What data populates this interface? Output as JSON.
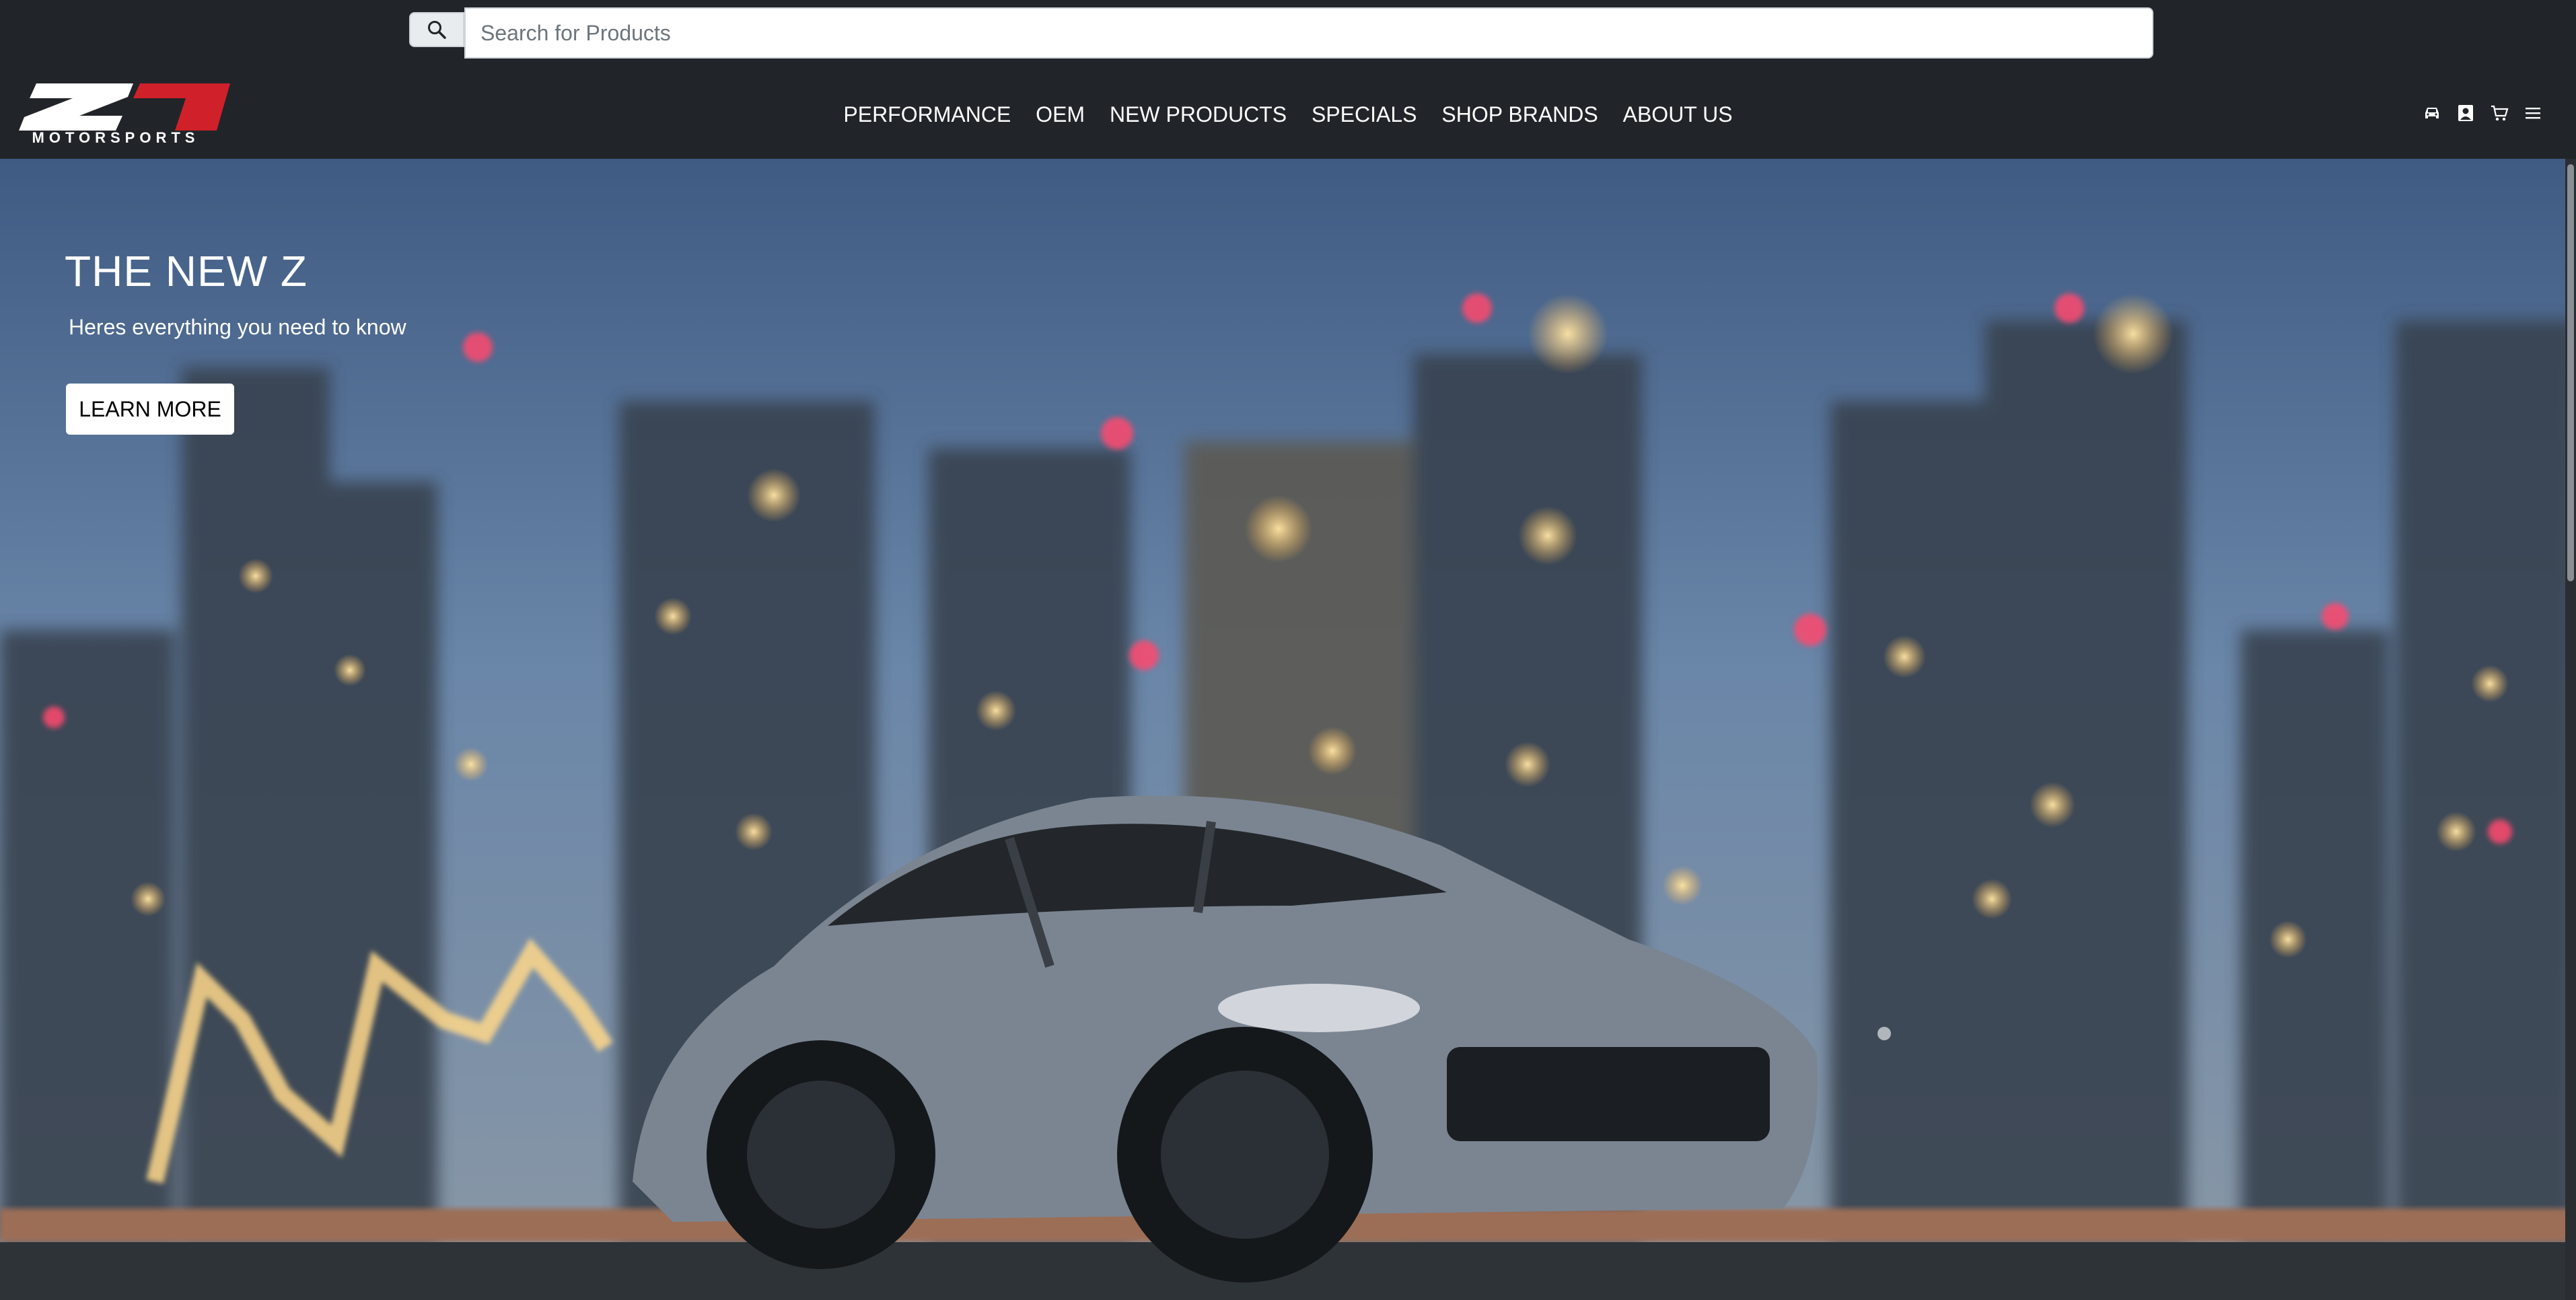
{
  "header": {
    "search": {
      "placeholder": "Search for Products",
      "value": ""
    },
    "logo": {
      "text": "MOTORSPORTS",
      "mark": "Z1"
    },
    "nav": [
      {
        "label": "PERFORMANCE"
      },
      {
        "label": "OEM"
      },
      {
        "label": "NEW PRODUCTS"
      },
      {
        "label": "SPECIALS"
      },
      {
        "label": "SHOP BRANDS"
      },
      {
        "label": "ABOUT US"
      }
    ],
    "utility_icons": [
      "garage-car-icon",
      "account-icon",
      "cart-icon",
      "menu-icon"
    ]
  },
  "hero": {
    "title": "THE NEW Z",
    "subtitle": "Heres everything you need to know",
    "cta_label": "LEARN MORE"
  },
  "colors": {
    "header_bg": "#212529",
    "brand_red": "#d0202a",
    "text_light": "#ffffff"
  }
}
